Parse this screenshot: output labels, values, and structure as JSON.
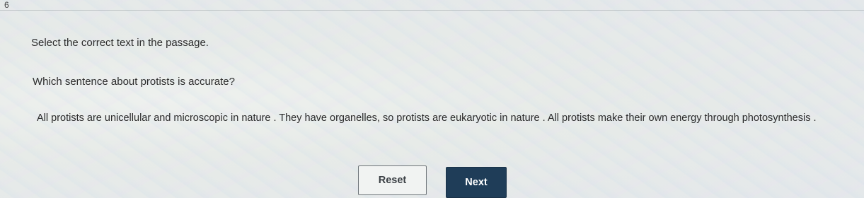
{
  "question_number": "6",
  "instruction": "Select the correct text in the passage.",
  "question": "Which sentence about protists is accurate?",
  "passage": {
    "sentences": [
      "All protists are unicellular and microscopic in nature .",
      "They have organelles, so protists are eukaryotic in nature .",
      "All protists make their own energy through photosynthesis ."
    ]
  },
  "buttons": {
    "reset_label": "Reset",
    "next_label": "Next"
  },
  "colors": {
    "next_bg": "#1f3d58",
    "reset_border": "#6d7378"
  }
}
